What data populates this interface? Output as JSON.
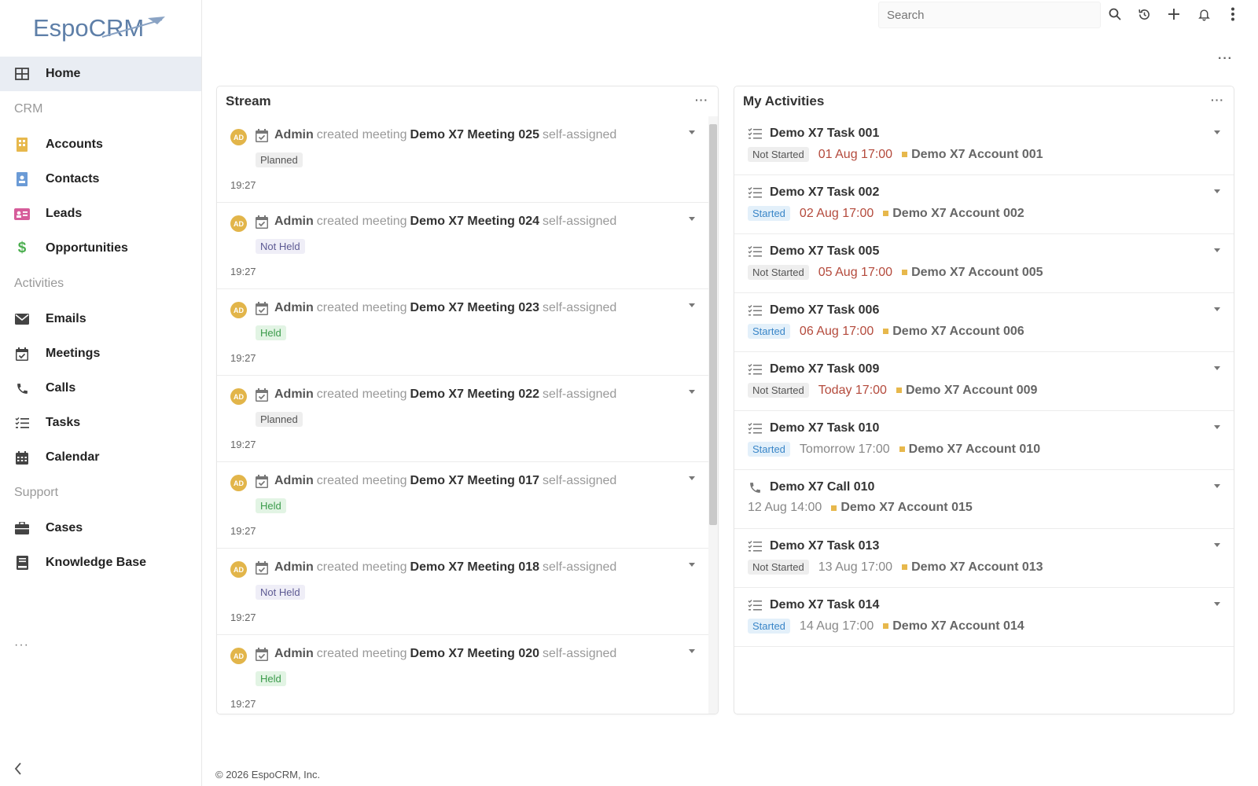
{
  "app": {
    "logo_text": "EspoCRM"
  },
  "search": {
    "placeholder": "Search"
  },
  "sidebar": {
    "home": "Home",
    "groups": [
      "CRM",
      "Activities",
      "Support"
    ],
    "crm": [
      "Accounts",
      "Contacts",
      "Leads",
      "Opportunities"
    ],
    "activities": [
      "Emails",
      "Meetings",
      "Calls",
      "Tasks",
      "Calendar"
    ],
    "support": [
      "Cases",
      "Knowledge Base"
    ],
    "more": "···"
  },
  "page_menu": "···",
  "stream": {
    "title": "Stream",
    "menu": "···",
    "items": [
      {
        "initials": "AD",
        "user": "Admin",
        "action": "created meeting",
        "name": "Demo X7 Meeting 025",
        "suffix": "self-assigned",
        "status": "Planned",
        "time": "19:27"
      },
      {
        "initials": "AD",
        "user": "Admin",
        "action": "created meeting",
        "name": "Demo X7 Meeting 024",
        "suffix": "self-assigned",
        "status": "Not Held",
        "time": "19:27"
      },
      {
        "initials": "AD",
        "user": "Admin",
        "action": "created meeting",
        "name": "Demo X7 Meeting 023",
        "suffix": "self-assigned",
        "status": "Held",
        "time": "19:27"
      },
      {
        "initials": "AD",
        "user": "Admin",
        "action": "created meeting",
        "name": "Demo X7 Meeting 022",
        "suffix": "self-assigned",
        "status": "Planned",
        "time": "19:27"
      },
      {
        "initials": "AD",
        "user": "Admin",
        "action": "created meeting",
        "name": "Demo X7 Meeting 017",
        "suffix": "self-assigned",
        "status": "Held",
        "time": "19:27"
      },
      {
        "initials": "AD",
        "user": "Admin",
        "action": "created meeting",
        "name": "Demo X7 Meeting 018",
        "suffix": "self-assigned",
        "status": "Not Held",
        "time": "19:27"
      },
      {
        "initials": "AD",
        "user": "Admin",
        "action": "created meeting",
        "name": "Demo X7 Meeting 020",
        "suffix": "self-assigned",
        "status": "Held",
        "time": "19:27"
      }
    ]
  },
  "activities": {
    "title": "My Activities",
    "menu": "···",
    "items": [
      {
        "type": "task",
        "name": "Demo X7 Task 001",
        "status": "Not Started",
        "date": "01 Aug 17:00",
        "overdue": true,
        "account": "Demo X7 Account 001"
      },
      {
        "type": "task",
        "name": "Demo X7 Task 002",
        "status": "Started",
        "date": "02 Aug 17:00",
        "overdue": true,
        "account": "Demo X7 Account 002"
      },
      {
        "type": "task",
        "name": "Demo X7 Task 005",
        "status": "Not Started",
        "date": "05 Aug 17:00",
        "overdue": true,
        "account": "Demo X7 Account 005"
      },
      {
        "type": "task",
        "name": "Demo X7 Task 006",
        "status": "Started",
        "date": "06 Aug 17:00",
        "overdue": true,
        "account": "Demo X7 Account 006"
      },
      {
        "type": "task",
        "name": "Demo X7 Task 009",
        "status": "Not Started",
        "date": "Today 17:00",
        "overdue": true,
        "account": "Demo X7 Account 009"
      },
      {
        "type": "task",
        "name": "Demo X7 Task 010",
        "status": "Started",
        "date": "Tomorrow 17:00",
        "overdue": false,
        "account": "Demo X7 Account 010"
      },
      {
        "type": "call",
        "name": "Demo X7 Call 010",
        "status": "",
        "date": "12 Aug 14:00",
        "overdue": false,
        "account": "Demo X7 Account 015"
      },
      {
        "type": "task",
        "name": "Demo X7 Task 013",
        "status": "Not Started",
        "date": "13 Aug 17:00",
        "overdue": false,
        "account": "Demo X7 Account 013"
      },
      {
        "type": "task",
        "name": "Demo X7 Task 014",
        "status": "Started",
        "date": "14 Aug 17:00",
        "overdue": false,
        "account": "Demo X7 Account 014"
      }
    ]
  },
  "footer": "© 2026 EspoCRM, Inc.",
  "colors": {
    "accounts": "#e7b84c",
    "contacts": "#6b9bd6",
    "leads": "#d65c9a",
    "opportunities": "#4caf50",
    "overdue": "#b44a3c"
  }
}
